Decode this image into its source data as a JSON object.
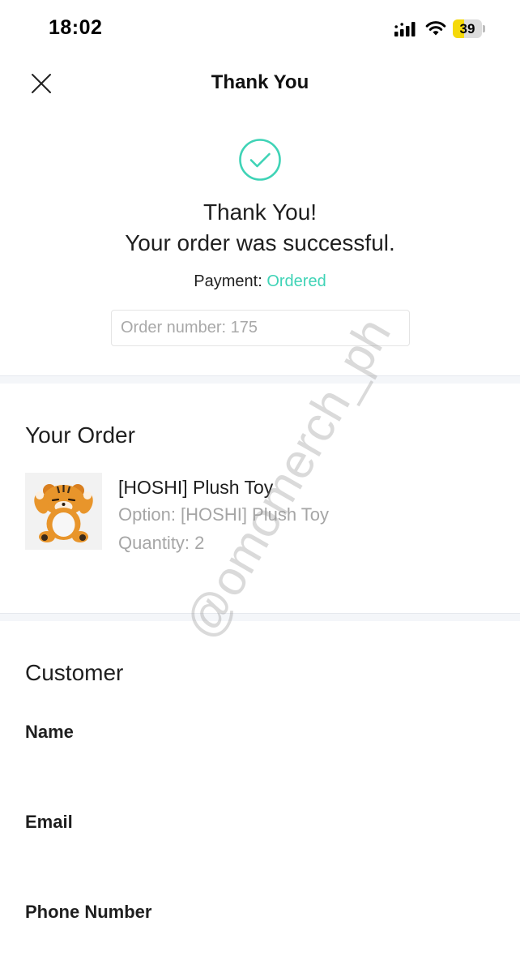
{
  "status_bar": {
    "time": "18:02",
    "battery": "39",
    "battery_level": 0.39,
    "battery_color": "#f5d90a",
    "icons": [
      "signal-icon",
      "wifi-icon",
      "battery-icon"
    ]
  },
  "header": {
    "title": "Thank You",
    "close_icon": "close-icon"
  },
  "success": {
    "icon": "check-circle-icon",
    "line1": "Thank You!",
    "line2": "Your order was successful.",
    "payment_label": "Payment:",
    "payment_status": "Ordered",
    "payment_status_color": "#3fd3b6",
    "order_number": "Order number: 175"
  },
  "order": {
    "title": "Your Order",
    "items": [
      {
        "image": "tiger-plush-toy-image",
        "name": "[HOSHI] Plush Toy",
        "option": "Option: [HOSHI] Plush Toy",
        "quantity": "Quantity: 2"
      }
    ]
  },
  "customer": {
    "title": "Customer",
    "name_label": "Name",
    "email_label": "Email",
    "phone_label": "Phone Number"
  },
  "watermark": "@omomerch_ph"
}
